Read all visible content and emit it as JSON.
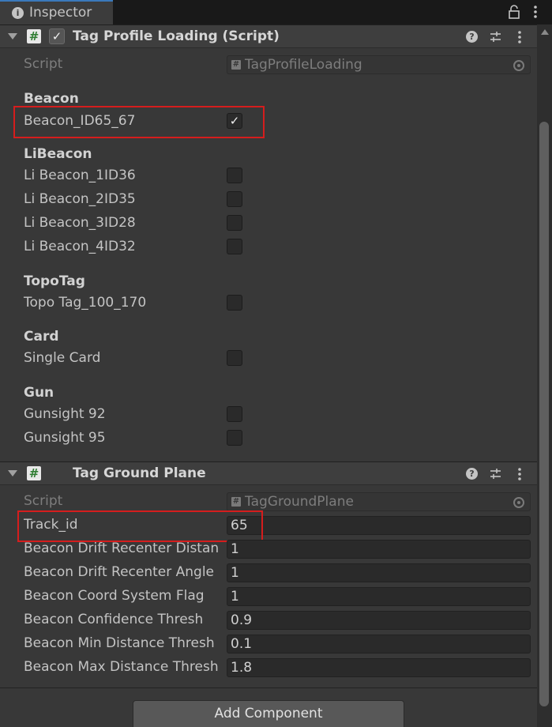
{
  "window": {
    "tab_label": "Inspector"
  },
  "component1": {
    "title": "Tag Profile Loading (Script)",
    "script_label": "Script",
    "script_value": "TagProfileLoading",
    "sections": {
      "beacon": "Beacon",
      "libeacon": "LiBeacon",
      "topotag": "TopoTag",
      "card": "Card",
      "gun": "Gun"
    },
    "fields": [
      {
        "label": "Beacon_ID65_67",
        "checked": true
      },
      {
        "label": "Li Beacon_1ID36",
        "checked": false
      },
      {
        "label": "Li Beacon_2ID35",
        "checked": false
      },
      {
        "label": "Li Beacon_3ID28",
        "checked": false
      },
      {
        "label": "Li Beacon_4ID32",
        "checked": false
      },
      {
        "label": "Topo Tag_100_170",
        "checked": false
      },
      {
        "label": "Single Card",
        "checked": false
      },
      {
        "label": "Gunsight 92",
        "checked": false
      },
      {
        "label": "Gunsight 95",
        "checked": false
      }
    ]
  },
  "component2": {
    "title": "Tag Ground Plane",
    "script_label": "Script",
    "script_value": "TagGroundPlane",
    "fields": [
      {
        "label": "Track_id",
        "value": "65"
      },
      {
        "label": "Beacon Drift Recenter Distan",
        "value": "1"
      },
      {
        "label": "Beacon Drift Recenter Angle",
        "value": "1"
      },
      {
        "label": "Beacon Coord System Flag",
        "value": "1"
      },
      {
        "label": "Beacon Confidence Thresh",
        "value": "0.9"
      },
      {
        "label": "Beacon Min Distance Thresh",
        "value": "0.1"
      },
      {
        "label": "Beacon Max Distance Thresh",
        "value": "1.8"
      }
    ]
  },
  "add_component_label": "Add Component",
  "icons": {
    "tab": "info-icon",
    "lock": "lock-icon",
    "menu": "kebab-icon",
    "help": "help-icon",
    "presets": "presets-icon",
    "script": "csharp-script-icon",
    "picker": "object-picker-icon",
    "fold": "foldout-arrow-icon"
  },
  "colors": {
    "highlight": "#d51d1d",
    "script_icon_bg": "#e8e8e8",
    "accent_tab": "#3a79bb"
  }
}
